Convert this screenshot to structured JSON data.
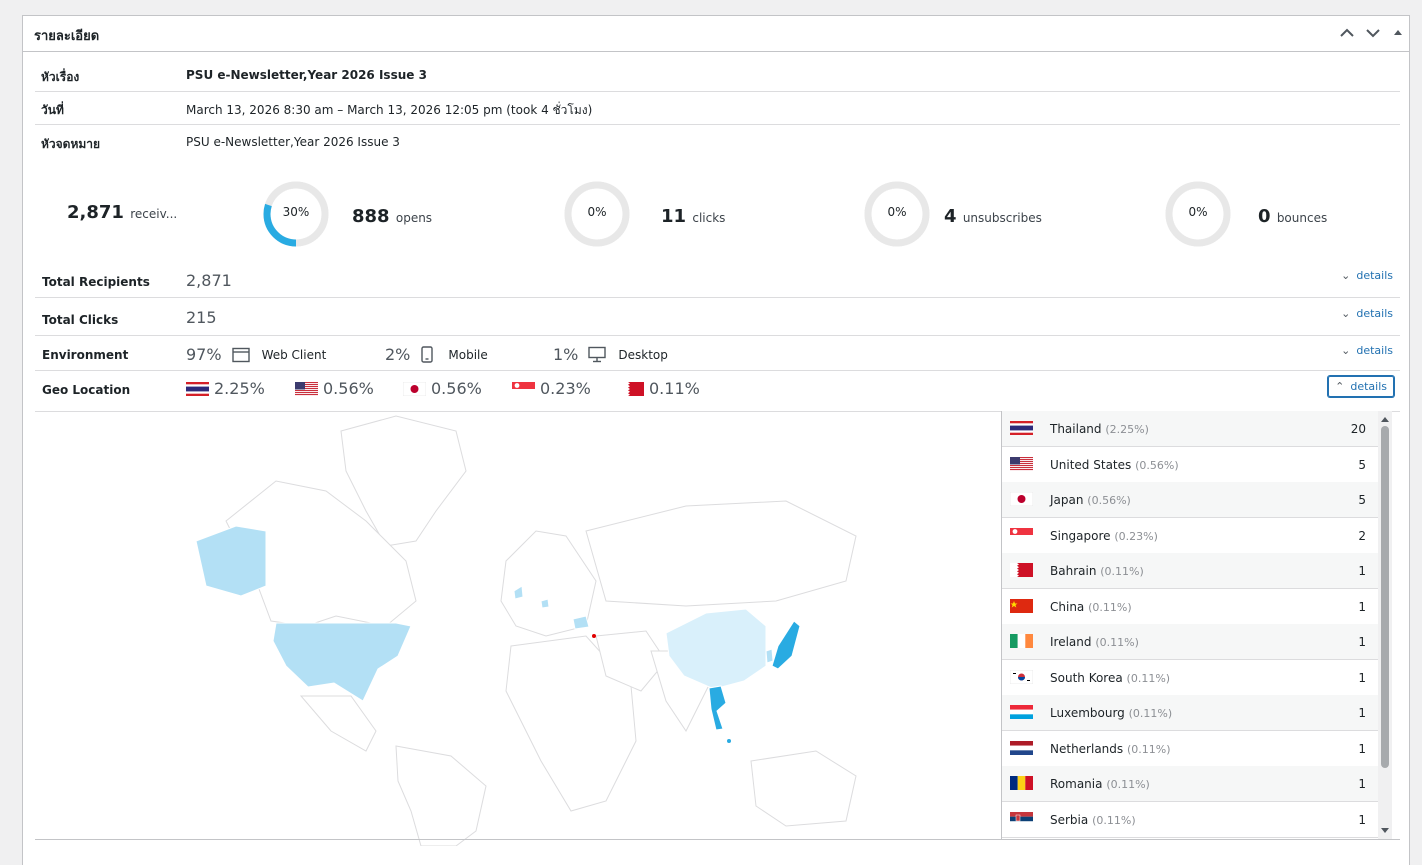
{
  "panel": {
    "title": "รายละเอียด"
  },
  "info": [
    {
      "label": "หัวเรื่อง",
      "value": "PSU e-Newsletter,Year 2026 Issue 3",
      "bold": true
    },
    {
      "label": "วันที่",
      "value": "March 13, 2026 8:30 am – March 13, 2026 12:05 pm (took 4 ชั่วโมง)",
      "bold": false
    },
    {
      "label": "หัวจดหมาย",
      "value": "PSU e-Newsletter,Year 2026 Issue 3",
      "bold": false
    }
  ],
  "stats": {
    "received": {
      "num": "2,871",
      "text": "receiv..."
    },
    "opens": {
      "pct": "30%",
      "fraction": 0.3,
      "num": "888",
      "text": "opens"
    },
    "clicks": {
      "pct": "0%",
      "fraction": 0,
      "num": "11",
      "text": "clicks"
    },
    "unsubscribes": {
      "pct": "0%",
      "fraction": 0,
      "num": "4",
      "text": "unsubscribes"
    },
    "bounces": {
      "pct": "0%",
      "fraction": 0,
      "num": "0",
      "text": "bounces"
    }
  },
  "details_label": "details",
  "total_recipients": {
    "label": "Total Recipients",
    "value": "2,871"
  },
  "total_clicks": {
    "label": "Total Clicks",
    "value": "215"
  },
  "environment": {
    "label": "Environment",
    "items": [
      {
        "pct": "97%",
        "name": "Web Client",
        "icon": "browser-window-icon"
      },
      {
        "pct": "2%",
        "name": "Mobile",
        "icon": "mobile-phone-icon"
      },
      {
        "pct": "1%",
        "name": "Desktop",
        "icon": "desktop-monitor-icon"
      }
    ]
  },
  "geo": {
    "label": "Geo Location",
    "top": [
      {
        "flag": "th",
        "pct": "2.25%"
      },
      {
        "flag": "us",
        "pct": "0.56%"
      },
      {
        "flag": "jp",
        "pct": "0.56%"
      },
      {
        "flag": "sg",
        "pct": "0.23%"
      },
      {
        "flag": "bh",
        "pct": "0.11%"
      }
    ]
  },
  "countries": [
    {
      "flag": "th",
      "name": "Thailand",
      "pct": "(2.25%)",
      "count": "20"
    },
    {
      "flag": "us",
      "name": "United States",
      "pct": "(0.56%)",
      "count": "5"
    },
    {
      "flag": "jp",
      "name": "Japan",
      "pct": "(0.56%)",
      "count": "5"
    },
    {
      "flag": "sg",
      "name": "Singapore",
      "pct": "(0.23%)",
      "count": "2"
    },
    {
      "flag": "bh",
      "name": "Bahrain",
      "pct": "(0.11%)",
      "count": "1"
    },
    {
      "flag": "cn",
      "name": "China",
      "pct": "(0.11%)",
      "count": "1"
    },
    {
      "flag": "ie",
      "name": "Ireland",
      "pct": "(0.11%)",
      "count": "1"
    },
    {
      "flag": "kr",
      "name": "South Korea",
      "pct": "(0.11%)",
      "count": "1"
    },
    {
      "flag": "lu",
      "name": "Luxembourg",
      "pct": "(0.11%)",
      "count": "1"
    },
    {
      "flag": "nl",
      "name": "Netherlands",
      "pct": "(0.11%)",
      "count": "1"
    },
    {
      "flag": "ro",
      "name": "Romania",
      "pct": "(0.11%)",
      "count": "1"
    },
    {
      "flag": "rs",
      "name": "Serbia",
      "pct": "(0.11%)",
      "count": "1"
    }
  ],
  "colors": {
    "accent": "#2271b1",
    "ring": "#29abe2",
    "ring_bg": "#e8e8e8",
    "map_light": "#b3e0f5",
    "map_high": "#29abe2"
  }
}
